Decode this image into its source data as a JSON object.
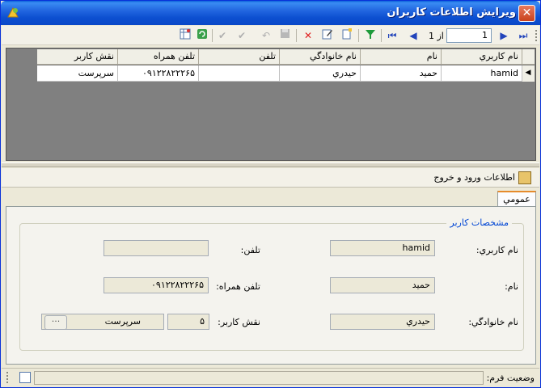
{
  "window": {
    "title": "ويرايش اطلاعات کاربران"
  },
  "toolbar": {
    "position_value": "1",
    "of_label": "از 1",
    "buttons": [
      {
        "name": "last-record-icon",
        "glyph": "⏮"
      },
      {
        "name": "next-record-icon",
        "glyph": "◀"
      },
      {
        "name": "prev-record-icon",
        "glyph": "▶"
      },
      {
        "name": "first-record-icon",
        "glyph": "⏭"
      }
    ]
  },
  "grid": {
    "columns": [
      "نام کاربري",
      "نام",
      "نام خانوادگي",
      "تلفن",
      "تلفن همراه",
      "نقش کاربر"
    ],
    "rows": [
      [
        "hamid",
        "حميد",
        "حيدري",
        "",
        "۰۹۱۲۲۸۲۲۲۶۵",
        "سرپرست"
      ]
    ]
  },
  "panel": {
    "title": "اطلاعات ورود و خروج"
  },
  "tabs": {
    "active_label": "عمومي"
  },
  "form": {
    "group_title": "مشخصات کاربر",
    "username_label": "نام کاربري:",
    "username_value": "hamid",
    "name_label": "نام:",
    "name_value": "حميد",
    "family_label": "نام خانوادگي:",
    "family_value": "حيدري",
    "phone_label": "تلفن:",
    "phone_value": "",
    "mobile_label": "تلفن همراه:",
    "mobile_value": "۰۹۱۲۲۸۲۲۲۶۵",
    "role_label": "نقش کاربر:",
    "role_code": "۵",
    "role_name": "سرپرست",
    "ellipsis_label": "···"
  },
  "status": {
    "label": "وضعيت فرم:"
  },
  "colors": {
    "title_blue": "#0a4fd0",
    "legend_blue": "#0046d5",
    "close_red": "#c9421c"
  }
}
